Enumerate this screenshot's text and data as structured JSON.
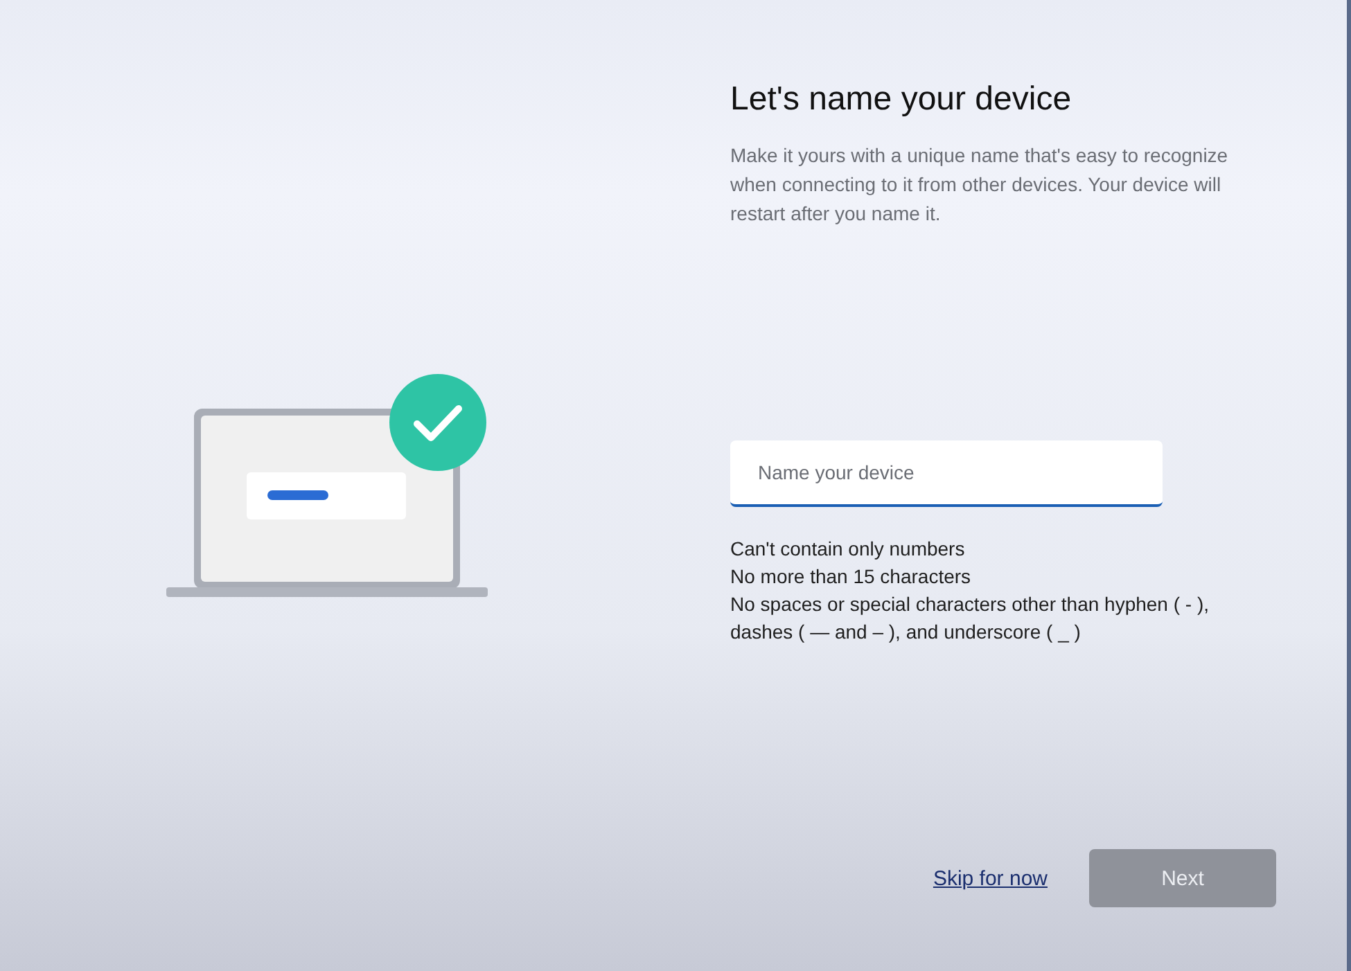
{
  "title": "Let's name your device",
  "description": "Make it yours with a unique name that's easy to recognize when connecting to it from other devices. Your device will restart after you name it.",
  "name_field": {
    "placeholder": "Name your device",
    "focused": true
  },
  "rules": [
    "Can't contain only numbers",
    "No more than 15 characters",
    "No spaces or special characters other than hyphen ( - ), dashes ( — and – ), and underscore ( _ )"
  ],
  "skip_link": {
    "label": "Skip for now"
  },
  "next_button": {
    "label": "Next",
    "disabled": true
  }
}
